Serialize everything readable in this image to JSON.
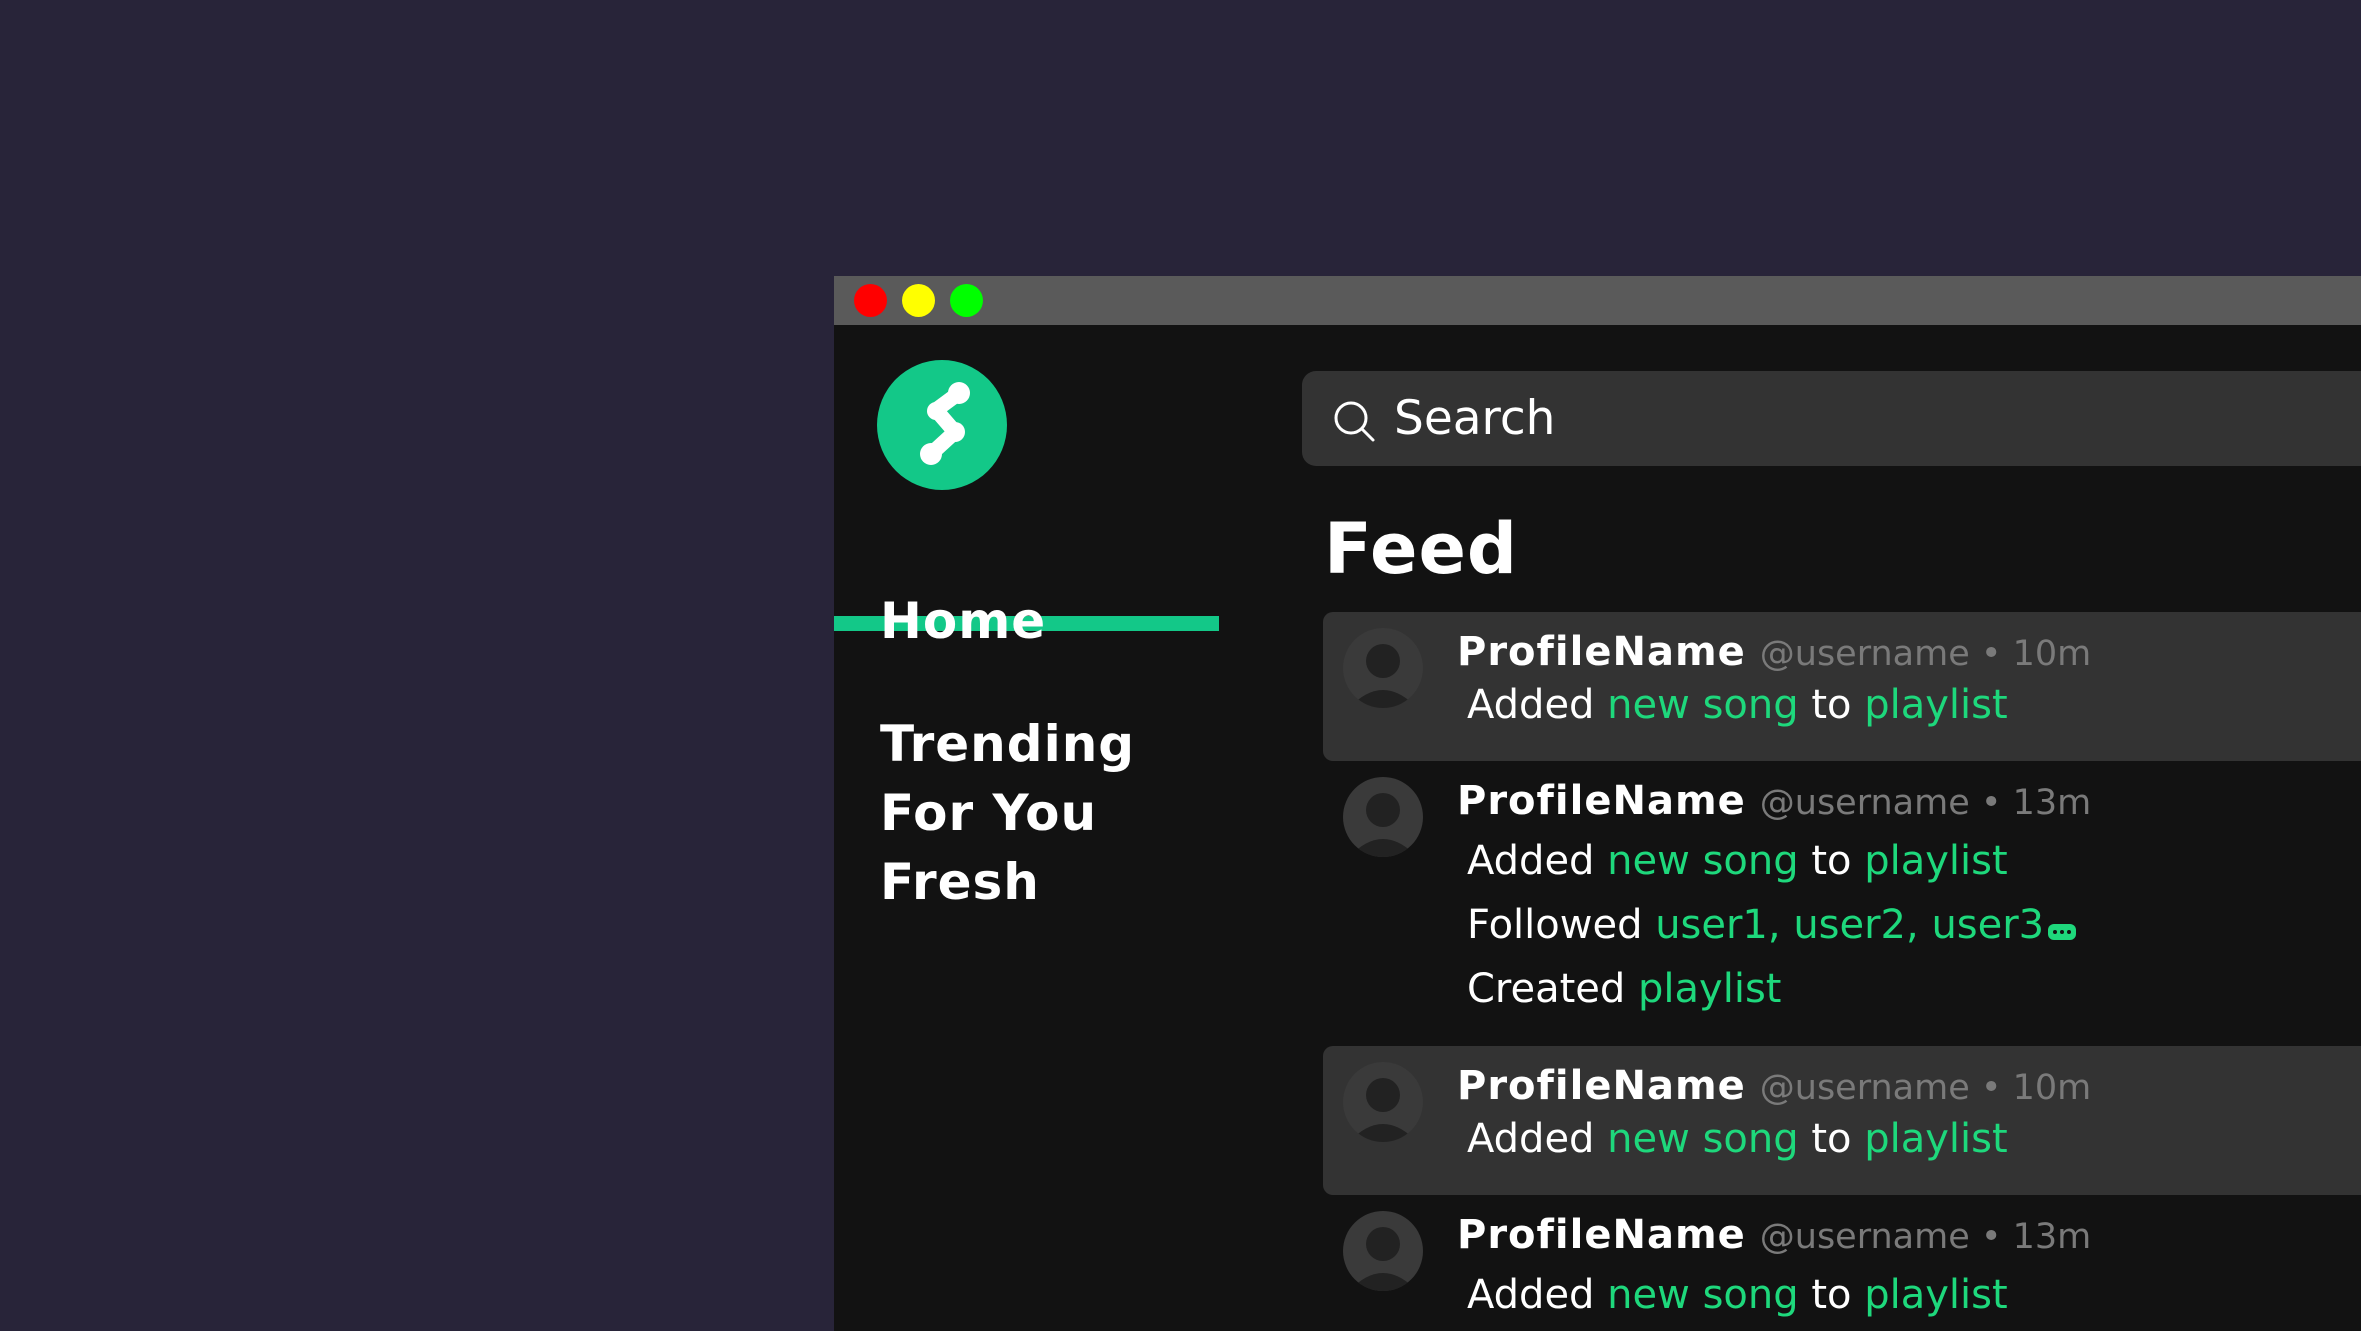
{
  "colors": {
    "background": "#282439",
    "window": "#121212",
    "titlebar": "#5a5a5a",
    "accent": "#13c888",
    "link": "#1ed87c",
    "card_highlight": "#333333"
  },
  "window_controls": [
    "close",
    "minimize",
    "maximize"
  ],
  "sidebar": {
    "logo_icon": "connected-nodes-logo",
    "items": [
      {
        "label": "Home",
        "active": true
      },
      {
        "label": "Trending"
      },
      {
        "label": "For You"
      },
      {
        "label": "Fresh"
      }
    ]
  },
  "search": {
    "icon": "search-icon",
    "placeholder": "Search"
  },
  "feed": {
    "title": "Feed",
    "posts": [
      {
        "profile_name": "ProfileName",
        "meta": "@username • 10m",
        "highlighted": true,
        "activities": [
          {
            "verb": "Added",
            "object": "new song",
            "connector": "to",
            "target": "playlist"
          }
        ]
      },
      {
        "profile_name": "ProfileName",
        "meta": "@username • 13m",
        "highlighted": false,
        "activities": [
          {
            "verb": "Added",
            "object": "new song",
            "connector": "to",
            "target": "playlist"
          },
          {
            "verb": "Followed",
            "object": "user1, user2, user3",
            "more_icon": "more-icon"
          },
          {
            "verb": "Created",
            "object": "playlist"
          }
        ]
      },
      {
        "profile_name": "ProfileName",
        "meta": "@username • 10m",
        "highlighted": true,
        "activities": [
          {
            "verb": "Added",
            "object": "new song",
            "connector": "to",
            "target": "playlist"
          }
        ]
      },
      {
        "profile_name": "ProfileName",
        "meta": "@username • 13m",
        "highlighted": false,
        "activities": [
          {
            "verb": "Added",
            "object": "new song",
            "connector": "to",
            "target": "playlist"
          }
        ]
      }
    ]
  }
}
